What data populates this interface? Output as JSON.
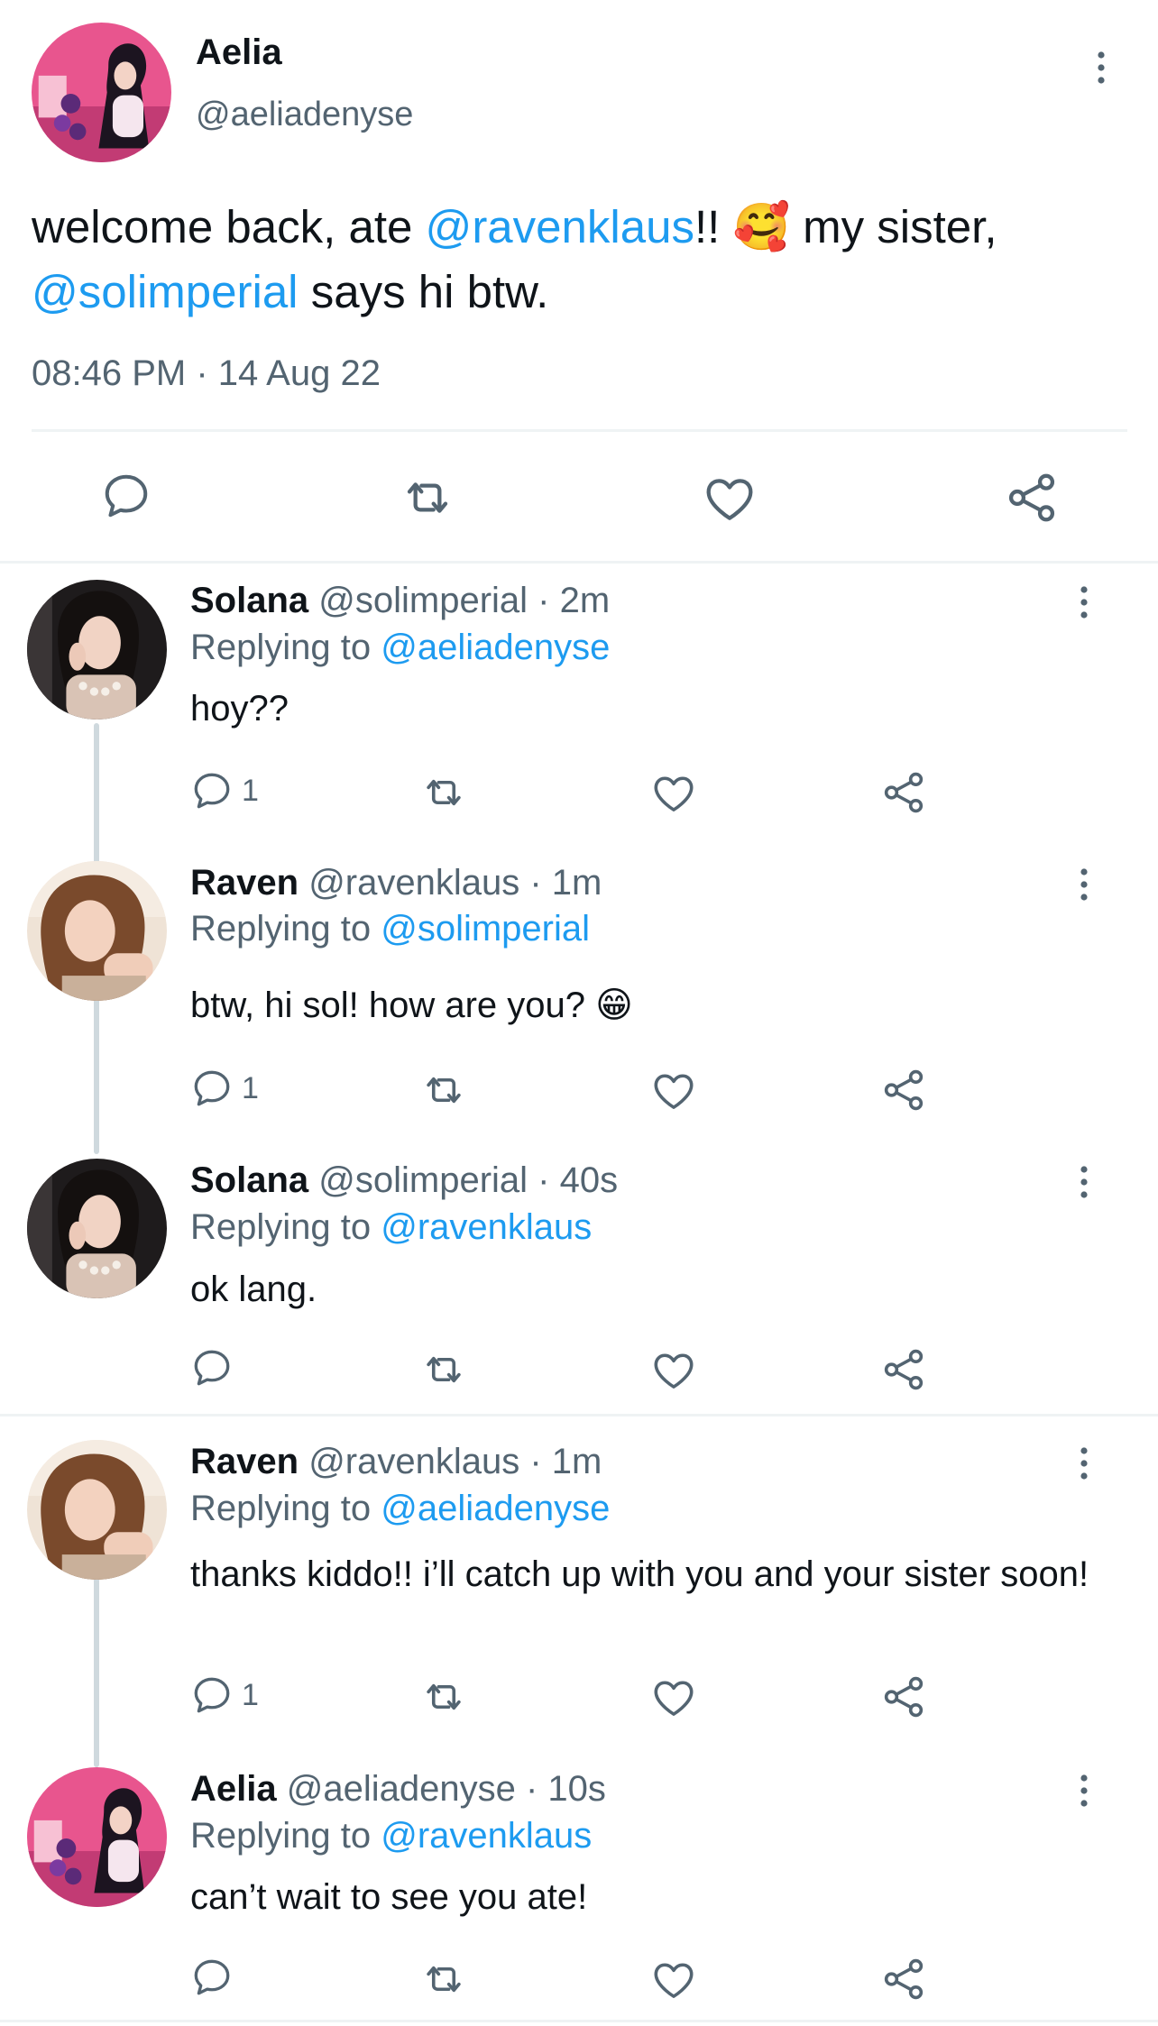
{
  "main_tweet": {
    "name": "Aelia",
    "handle": "@aeliadenyse",
    "text_part1": "welcome back, ate ",
    "mention1": "@ravenklaus",
    "text_part2": "!! ",
    "emoji": "🥰",
    "text_part3": " my sister,",
    "mention2": "@solimperial",
    "text_part4": " says hi btw.",
    "timestamp": "08:46 PM · 14 Aug 22"
  },
  "replies": [
    {
      "name": "Solana",
      "handle_time": "@solimperial · 2m",
      "replying_prefix": "Replying to ",
      "replying_to": "@aeliadenyse",
      "text": "hoy??",
      "reply_count": "1"
    },
    {
      "name": "Raven",
      "handle_time": "@ravenklaus · 1m",
      "replying_prefix": "Replying to ",
      "replying_to": "@solimperial",
      "text": "btw, hi sol! how are you? 😁",
      "reply_count": "1"
    },
    {
      "name": "Solana",
      "handle_time": "@solimperial · 40s",
      "replying_prefix": "Replying to ",
      "replying_to": "@ravenklaus",
      "text": "ok lang.",
      "reply_count": ""
    },
    {
      "name": "Raven",
      "handle_time": "@ravenklaus · 1m",
      "replying_prefix": "Replying to ",
      "replying_to": "@aeliadenyse",
      "text": "thanks kiddo!! i’ll catch up with you and your sister soon!",
      "reply_count": "1"
    },
    {
      "name": "Aelia",
      "handle_time": "@aeliadenyse · 10s",
      "replying_prefix": "Replying to ",
      "replying_to": "@ravenklaus",
      "text": "can’t wait to see you ate!",
      "reply_count": ""
    }
  ],
  "icons": {
    "reply": "reply-icon",
    "retweet": "retweet-icon",
    "like": "heart-icon",
    "share": "share-icon",
    "more": "more-vertical-icon"
  },
  "colors": {
    "link": "#1d9bf0",
    "muted": "#536471",
    "icon": "#536471",
    "divider": "#eff3f4",
    "thread_line": "#cfd9de"
  }
}
